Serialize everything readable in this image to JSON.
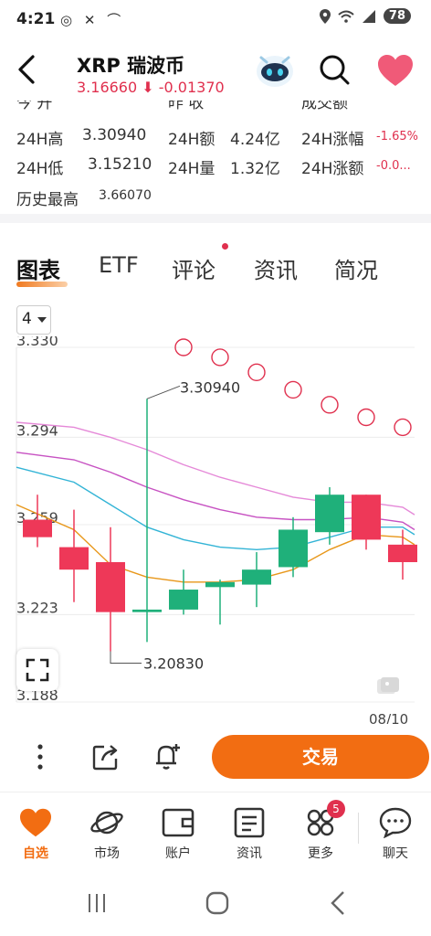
{
  "status_bar": {
    "time": "4:21",
    "icons_text": "◎ ✕ ⌒",
    "battery": "78"
  },
  "header": {
    "coin_name": "XRP  瑞波币",
    "price": "3.16660",
    "change": "-0.01370"
  },
  "stats": {
    "partial_row": {
      "a": "今  开",
      "b": "昨  收",
      "c": "成交额"
    },
    "rows": [
      {
        "l1": "24H高",
        "v1": "3.30940",
        "l2": "24H额",
        "v2": "4.24亿",
        "l3": "24H涨幅",
        "v3": "-1.65%"
      },
      {
        "l1": "24H低",
        "v1": "3.15210",
        "l2": "24H量",
        "v2": "1.32亿",
        "l3": "24H涨额",
        "v3": "-0.0..."
      }
    ],
    "ath_label": "历史最高",
    "ath_value": "3.66070"
  },
  "tabs": [
    "图表",
    "ETF",
    "评论",
    "资讯",
    "简况"
  ],
  "interval": "4",
  "chart_data": {
    "type": "candlestick",
    "y_ticks": [
      "3.330",
      "3.294",
      "3.259",
      "3.223",
      "3.188"
    ],
    "ylim": [
      3.188,
      3.33
    ],
    "candles": [
      {
        "o": 3.261,
        "h": 3.271,
        "l": 3.25,
        "c": 3.254
      },
      {
        "o": 3.25,
        "h": 3.265,
        "l": 3.228,
        "c": 3.241
      },
      {
        "o": 3.244,
        "h": 3.258,
        "l": 3.2083,
        "c": 3.224
      },
      {
        "o": 3.224,
        "h": 3.3094,
        "l": 3.212,
        "c": 3.225
      },
      {
        "o": 3.225,
        "h": 3.241,
        "l": 3.223,
        "c": 3.233
      },
      {
        "o": 3.234,
        "h": 3.237,
        "l": 3.219,
        "c": 3.236
      },
      {
        "o": 3.235,
        "h": 3.248,
        "l": 3.226,
        "c": 3.241
      },
      {
        "o": 3.242,
        "h": 3.262,
        "l": 3.238,
        "c": 3.257
      },
      {
        "o": 3.256,
        "h": 3.274,
        "l": 3.251,
        "c": 3.271
      },
      {
        "o": 3.271,
        "h": 3.271,
        "l": 3.249,
        "c": 3.253
      },
      {
        "o": 3.251,
        "h": 3.257,
        "l": 3.237,
        "c": 3.244
      }
    ],
    "ma": [
      {
        "color": "#e8971a",
        "values": [
          3.267,
          3.257,
          3.243,
          3.238,
          3.236,
          3.236,
          3.237,
          3.241,
          3.249,
          3.255,
          3.254
        ]
      },
      {
        "color": "#33b4d6",
        "values": [
          3.282,
          3.276,
          3.267,
          3.258,
          3.253,
          3.25,
          3.249,
          3.25,
          3.254,
          3.258,
          3.258
        ]
      },
      {
        "color": "#c752c2",
        "values": [
          3.288,
          3.285,
          3.28,
          3.274,
          3.269,
          3.265,
          3.262,
          3.261,
          3.261,
          3.262,
          3.26
        ]
      },
      {
        "color": "#e589d8",
        "values": [
          3.3,
          3.298,
          3.294,
          3.289,
          3.283,
          3.278,
          3.274,
          3.27,
          3.268,
          3.268,
          3.266
        ]
      }
    ],
    "sar": [
      3.33,
      3.326,
      3.32,
      3.313,
      3.307,
      3.302,
      3.298
    ],
    "annotations": {
      "high": "3.30940",
      "low": "3.20830"
    },
    "date_label": "08/10",
    "colors": {
      "up": "#1fb07a",
      "down": "#ee3858",
      "sar": "#e0304e"
    }
  },
  "trade_button": "交易",
  "nav": [
    {
      "label": "自选",
      "icon": "heart-icon"
    },
    {
      "label": "市场",
      "icon": "planet-icon"
    },
    {
      "label": "账户",
      "icon": "wallet-icon"
    },
    {
      "label": "资讯",
      "icon": "document-icon"
    },
    {
      "label": "更多",
      "icon": "grid-icon"
    },
    {
      "label": "聊天",
      "icon": "chat-icon"
    }
  ],
  "nav_badge": "5"
}
